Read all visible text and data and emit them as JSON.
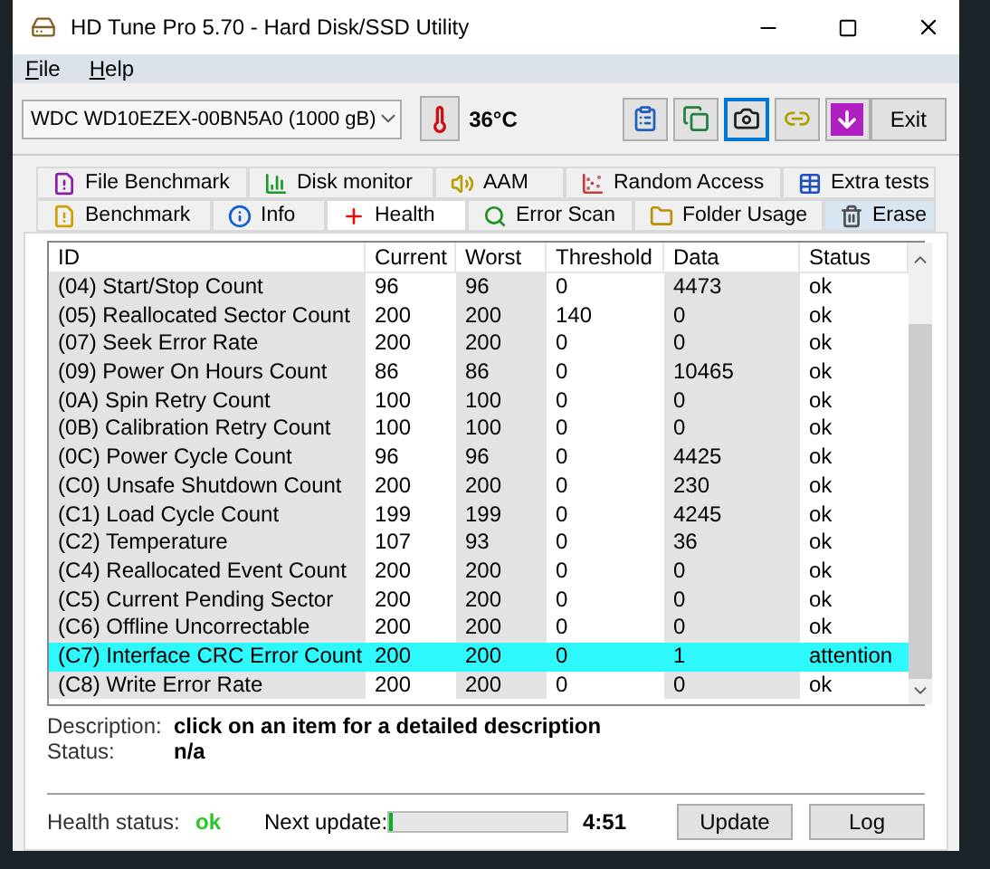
{
  "window": {
    "title": "HD Tune Pro 5.70 - Hard Disk/SSD Utility"
  },
  "menu": [
    {
      "label": "File"
    },
    {
      "label": "Help"
    }
  ],
  "toolbar": {
    "drive": "WDC WD10EZEX-00BN5A0 (1000 gB)",
    "temperature": "36°C",
    "icon_buttons": [
      {
        "focused": false
      },
      {
        "focused": false
      },
      {
        "focused": true
      },
      {
        "focused": false
      },
      {
        "focused": false
      }
    ],
    "exit": "Exit"
  },
  "tabs_top": [
    {
      "label": "File Benchmark",
      "selected": false,
      "highlighted": false
    },
    {
      "label": "Disk monitor",
      "selected": false,
      "highlighted": false
    },
    {
      "label": "AAM",
      "selected": false,
      "highlighted": false
    },
    {
      "label": "Random Access",
      "selected": false,
      "highlighted": false
    },
    {
      "label": "Extra tests",
      "selected": false,
      "highlighted": false
    }
  ],
  "tabs_bottom": [
    {
      "label": "Benchmark",
      "selected": false,
      "highlighted": false
    },
    {
      "label": "Info",
      "selected": false,
      "highlighted": false
    },
    {
      "label": "Health",
      "selected": true,
      "highlighted": false
    },
    {
      "label": "Error Scan",
      "selected": false,
      "highlighted": false
    },
    {
      "label": "Folder Usage",
      "selected": false,
      "highlighted": false
    },
    {
      "label": "Erase",
      "selected": false,
      "highlighted": true
    }
  ],
  "table": {
    "columns": [
      "ID",
      "Current",
      "Worst",
      "Threshold",
      "Data",
      "Status"
    ],
    "rows": [
      {
        "cells": [
          "(04) Start/Stop Count",
          "96",
          "96",
          "0",
          "4473",
          "ok"
        ],
        "selected": false
      },
      {
        "cells": [
          "(05) Reallocated Sector Count",
          "200",
          "200",
          "140",
          "0",
          "ok"
        ],
        "selected": false
      },
      {
        "cells": [
          "(07) Seek Error Rate",
          "200",
          "200",
          "0",
          "0",
          "ok"
        ],
        "selected": false
      },
      {
        "cells": [
          "(09) Power On Hours Count",
          "86",
          "86",
          "0",
          "10465",
          "ok"
        ],
        "selected": false
      },
      {
        "cells": [
          "(0A) Spin Retry Count",
          "100",
          "100",
          "0",
          "0",
          "ok"
        ],
        "selected": false
      },
      {
        "cells": [
          "(0B) Calibration Retry Count",
          "100",
          "100",
          "0",
          "0",
          "ok"
        ],
        "selected": false
      },
      {
        "cells": [
          "(0C) Power Cycle Count",
          "96",
          "96",
          "0",
          "4425",
          "ok"
        ],
        "selected": false
      },
      {
        "cells": [
          "(C0) Unsafe Shutdown Count",
          "200",
          "200",
          "0",
          "230",
          "ok"
        ],
        "selected": false
      },
      {
        "cells": [
          "(C1) Load Cycle Count",
          "199",
          "199",
          "0",
          "4245",
          "ok"
        ],
        "selected": false
      },
      {
        "cells": [
          "(C2) Temperature",
          "107",
          "93",
          "0",
          "36",
          "ok"
        ],
        "selected": false
      },
      {
        "cells": [
          "(C4) Reallocated Event Count",
          "200",
          "200",
          "0",
          "0",
          "ok"
        ],
        "selected": false
      },
      {
        "cells": [
          "(C5) Current Pending Sector",
          "200",
          "200",
          "0",
          "0",
          "ok"
        ],
        "selected": false
      },
      {
        "cells": [
          "(C6) Offline Uncorrectable",
          "200",
          "200",
          "0",
          "0",
          "ok"
        ],
        "selected": false
      },
      {
        "cells": [
          "(C7) Interface CRC Error Count",
          "200",
          "200",
          "0",
          "1",
          "attention"
        ],
        "selected": true
      },
      {
        "cells": [
          "(C8) Write Error Rate",
          "200",
          "200",
          "0",
          "0",
          "ok"
        ],
        "selected": false
      }
    ]
  },
  "details": [
    {
      "label": "Description:",
      "value": "click on an item for a detailed description"
    },
    {
      "label": "Status:",
      "value": "n/a"
    }
  ],
  "footer": {
    "health_label": "Health status:",
    "health_value": "ok",
    "health_ok": true,
    "next_label": "Next update:",
    "level": 0.02,
    "time": "4:51",
    "buttons": [
      "Update",
      "Log"
    ]
  }
}
